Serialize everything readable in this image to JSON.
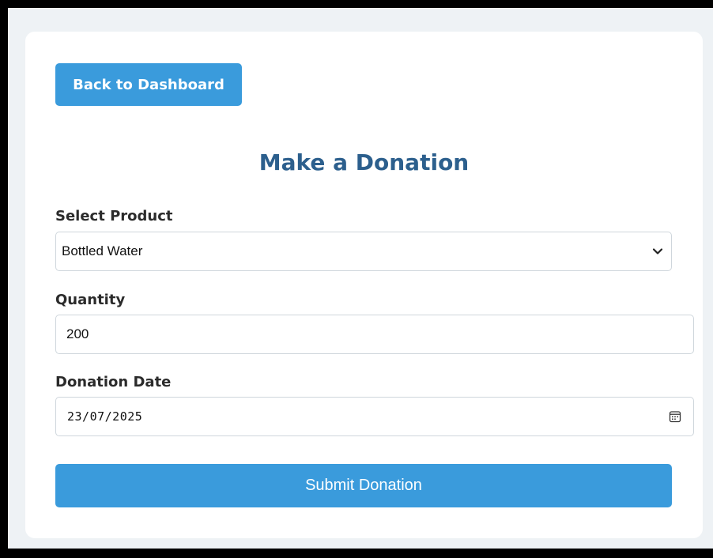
{
  "navigation": {
    "back_label": "Back to Dashboard"
  },
  "form": {
    "title": "Make a Donation",
    "product": {
      "label": "Select Product",
      "selected": "Bottled Water"
    },
    "quantity": {
      "label": "Quantity",
      "value": "200"
    },
    "date": {
      "label": "Donation Date",
      "value": "23/07/2025"
    },
    "submit_label": "Submit Donation"
  },
  "icons": {
    "select_arrow": "chevron-down-icon",
    "date_picker": "calendar-icon"
  },
  "colors": {
    "accent": "#3a9bdc",
    "title": "#2c5f8d",
    "page_background": "#eef2f5",
    "card": "#ffffff"
  }
}
